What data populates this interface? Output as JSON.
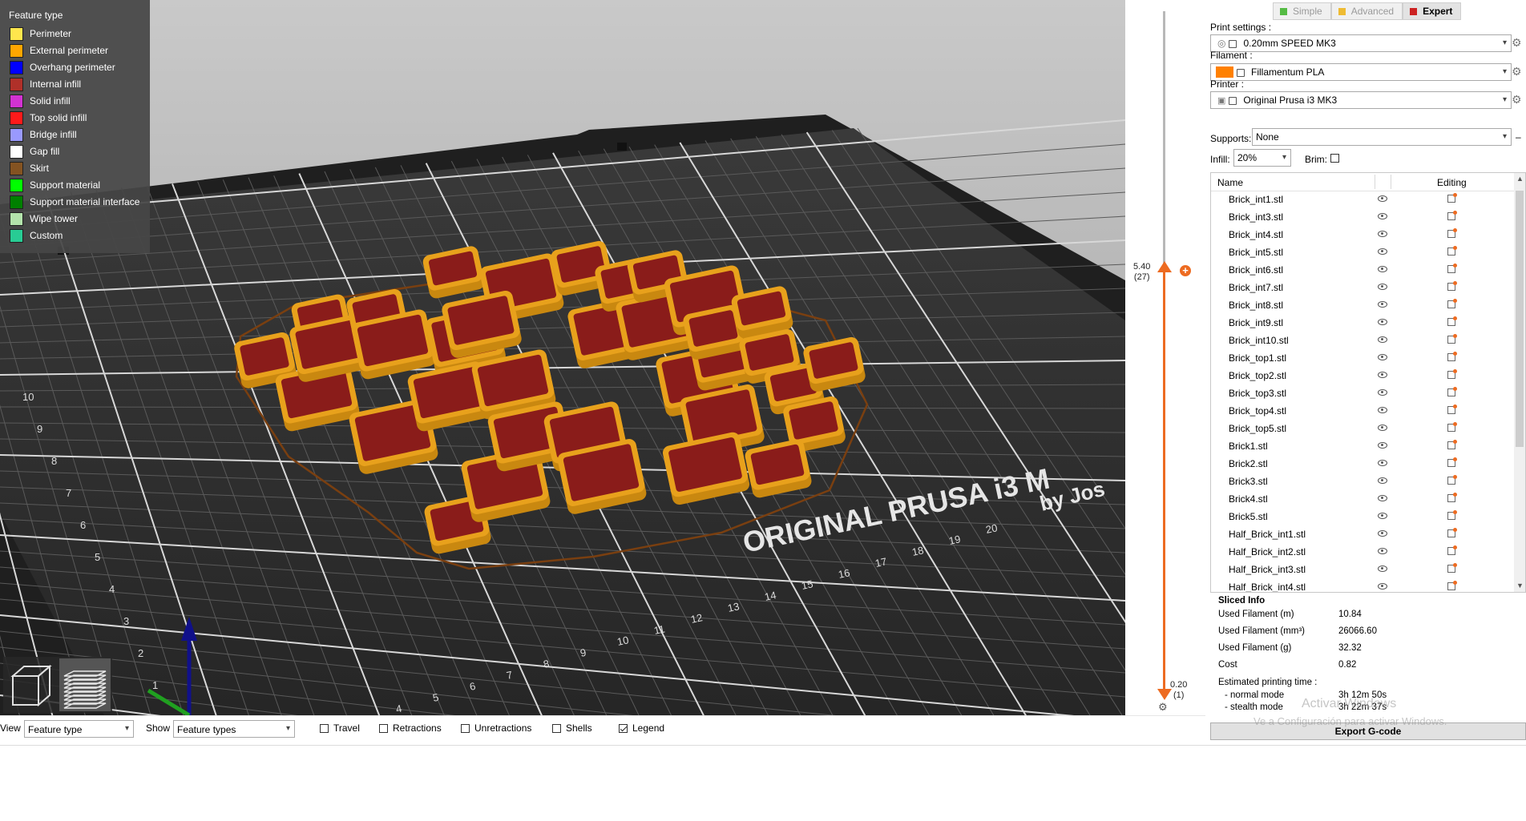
{
  "legend": {
    "title": "Feature type",
    "items": [
      {
        "label": "Perimeter",
        "color": "#ffe64d"
      },
      {
        "label": "External perimeter",
        "color": "#ffa600"
      },
      {
        "label": "Overhang perimeter",
        "color": "#0000ff"
      },
      {
        "label": "Internal infill",
        "color": "#b03029"
      },
      {
        "label": "Solid infill",
        "color": "#d232d2"
      },
      {
        "label": "Top solid infill",
        "color": "#ff1a1a"
      },
      {
        "label": "Bridge infill",
        "color": "#9999ff"
      },
      {
        "label": "Gap fill",
        "color": "#ffffff"
      },
      {
        "label": "Skirt",
        "color": "#845321"
      },
      {
        "label": "Support material",
        "color": "#00ff00"
      },
      {
        "label": "Support material interface",
        "color": "#008000"
      },
      {
        "label": "Wipe tower",
        "color": "#b3e3ab"
      },
      {
        "label": "Custom",
        "color": "#28cc94"
      }
    ]
  },
  "bed": {
    "brand_line1": "ORIGINAL PRUSA i3 M",
    "brand_line2": "by Jos",
    "axis_numbers_bottom": [
      "4",
      "5",
      "6",
      "7",
      "8",
      "9",
      "10",
      "11",
      "12",
      "13",
      "14",
      "15",
      "16",
      "17",
      "18",
      "19",
      "20"
    ],
    "axis_numbers_left": [
      "1",
      "2",
      "3",
      "4",
      "5",
      "6",
      "7",
      "8",
      "9",
      "10"
    ]
  },
  "layer_slider": {
    "top_height": "5.40",
    "top_layer": "(27)",
    "bottom_height": "0.20",
    "bottom_layer": "(1)",
    "add_icon": "+"
  },
  "mode_tabs": [
    {
      "label": "Simple",
      "color": "#55bb44",
      "active": false
    },
    {
      "label": "Advanced",
      "color": "#eebb33",
      "active": false
    },
    {
      "label": "Expert",
      "color": "#cc2222",
      "active": true
    }
  ],
  "settings": {
    "print_label": "Print settings :",
    "print_value": "0.20mm SPEED MK3",
    "filament_label": "Filament :",
    "filament_value": "Fillamentum PLA",
    "filament_color": "#ff8000",
    "printer_label": "Printer :",
    "printer_value": "Original Prusa i3 MK3",
    "supports_label": "Supports:",
    "supports_value": "None",
    "infill_label": "Infill:",
    "infill_value": "20%",
    "brim_label": "Brim:"
  },
  "object_list": {
    "col_name": "Name",
    "col_editing": "Editing",
    "items": [
      "Brick_int1.stl",
      "Brick_int3.stl",
      "Brick_int4.stl",
      "Brick_int5.stl",
      "Brick_int6.stl",
      "Brick_int7.stl",
      "Brick_int8.stl",
      "Brick_int9.stl",
      "Brick_int10.stl",
      "Brick_top1.stl",
      "Brick_top2.stl",
      "Brick_top3.stl",
      "Brick_top4.stl",
      "Brick_top5.stl",
      "Brick1.stl",
      "Brick2.stl",
      "Brick3.stl",
      "Brick4.stl",
      "Brick5.stl",
      "Half_Brick_int1.stl",
      "Half_Brick_int2.stl",
      "Half_Brick_int3.stl",
      "Half_Brick_int4.stl"
    ]
  },
  "sliced_info": {
    "title": "Sliced Info",
    "rows": [
      {
        "label": "Used Filament (m)",
        "value": "10.84"
      },
      {
        "label": "Used Filament (mm³)",
        "value": "26066.60"
      },
      {
        "label": "Used Filament (g)",
        "value": "32.32"
      },
      {
        "label": "Cost",
        "value": "0.82"
      }
    ],
    "time_title": "Estimated printing time :",
    "normal_label": "- normal mode",
    "normal_value": "3h 12m 50s",
    "stealth_label": "- stealth mode",
    "stealth_value": "3h 22m 37s"
  },
  "watermark": {
    "line1": "Activar Windows",
    "line2": "Ve a Configuración para activar Windows."
  },
  "export_button": "Export G-code",
  "bottom_bar": {
    "view_label": "View",
    "view_value": "Feature type",
    "show_label": "Show",
    "show_value": "Feature types",
    "travel": {
      "label": "Travel",
      "checked": false
    },
    "retractions": {
      "label": "Retractions",
      "checked": false
    },
    "unretractions": {
      "label": "Unretractions",
      "checked": false
    },
    "shells": {
      "label": "Shells",
      "checked": false
    },
    "legend": {
      "label": "Legend",
      "checked": true
    }
  },
  "colors": {
    "accent": "#ed6b21",
    "brick_wall": "#e8a11c",
    "brick_infill": "#8a1c1a",
    "bed": "#2b2b2b"
  }
}
